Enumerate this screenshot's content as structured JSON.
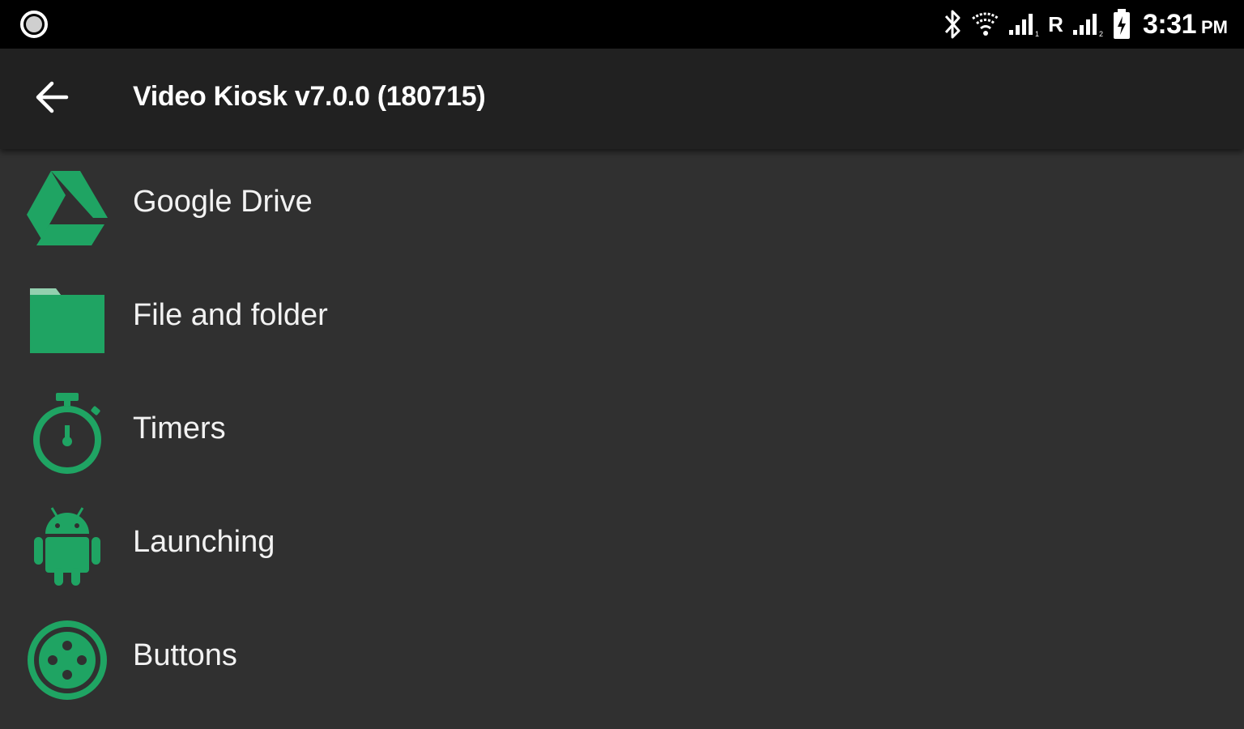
{
  "status_bar": {
    "left_icon": "circle-notification-icon",
    "icons": [
      "bluetooth-icon",
      "wifi-icon",
      "signal-sim1-icon",
      "signal-sim2-icon",
      "battery-charging-icon"
    ],
    "roaming": "R",
    "time": "3:31",
    "ampm": "PM"
  },
  "app_bar": {
    "back_icon": "back-arrow-icon",
    "title": "Video Kiosk v7.0.0 (180715)"
  },
  "menu": {
    "accent_color": "#1fa463",
    "items": [
      {
        "label": "Google Drive",
        "icon": "google-drive-icon"
      },
      {
        "label": "File and folder",
        "icon": "folder-icon"
      },
      {
        "label": "Timers",
        "icon": "stopwatch-icon"
      },
      {
        "label": "Launching",
        "icon": "android-icon"
      },
      {
        "label": "Buttons",
        "icon": "buttons-icon"
      }
    ]
  },
  "colors": {
    "status_bar": "#000000",
    "app_bar": "#212121",
    "background": "#303030",
    "text": "#f2f2f2"
  }
}
